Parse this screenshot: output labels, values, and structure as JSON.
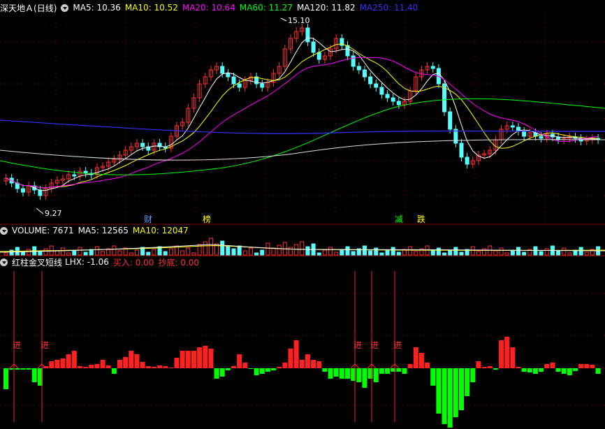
{
  "main": {
    "stock_name": "深天地Ａ",
    "period": "(日线)",
    "indicators": [
      {
        "label": "MA5: 10.36",
        "color": "#ffffff"
      },
      {
        "label": "MA10: 10.52",
        "color": "#ffff00"
      },
      {
        "label": "MA20: 10.64",
        "color": "#ff00ff"
      },
      {
        "label": "MA60: 11.27",
        "color": "#00ff00"
      },
      {
        "label": "MA120: 11.82",
        "color": "#ffffff"
      },
      {
        "label": "MA250: 11.40",
        "color": "#3333ff"
      }
    ],
    "high_label": "15.10",
    "low_label": "9.27",
    "markers": [
      "财",
      "榜",
      "减",
      "跌"
    ]
  },
  "volume": {
    "title": "VOLUME: 7671",
    "ma5": "MA5: 12565",
    "ma10": "MA10: 12047"
  },
  "indicator": {
    "title": "红柱金叉短线",
    "lhx": "LHX: -1.06",
    "buy": "买入: 0.00",
    "bottom": "抄底: 0.00",
    "signal_label": "进"
  },
  "colors": {
    "up": "#ff3030",
    "down": "#54ffff",
    "green": "#00ff00",
    "grid": "#8b0000"
  }
}
